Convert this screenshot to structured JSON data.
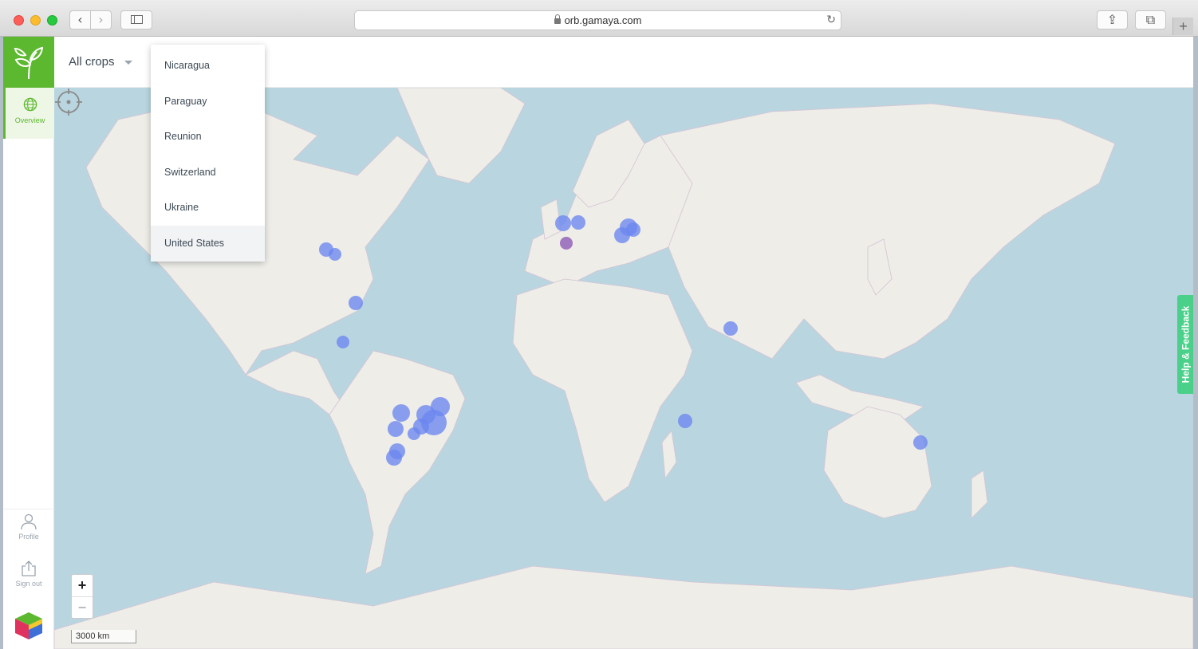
{
  "browser": {
    "url": "orb.gamaya.com",
    "back_icon": "‹",
    "forward_icon": "›",
    "reload_icon": "↻",
    "share_icon": "⇪",
    "tabs_icon": "⧉",
    "new_tab_icon": "+"
  },
  "app": {
    "brand_color": "#5cb82e",
    "nav": {
      "overview_label": "Overview",
      "profile_label": "Profile",
      "signout_label": "Sign out"
    },
    "topbar": {
      "crop_filter": "All crops"
    },
    "country_dropdown": {
      "items": [
        "Nicaragua",
        "Paraguay",
        "Reunion",
        "Switzerland",
        "Ukraine",
        "United States"
      ],
      "selected": "United States"
    },
    "map": {
      "zoom_in_label": "+",
      "zoom_out_label": "−",
      "scale_label": "3000 km",
      "help_feedback_label": "Help & Feedback",
      "marker_color": "#6b86ef",
      "highlight_marker_color": "#c0397a"
    }
  }
}
